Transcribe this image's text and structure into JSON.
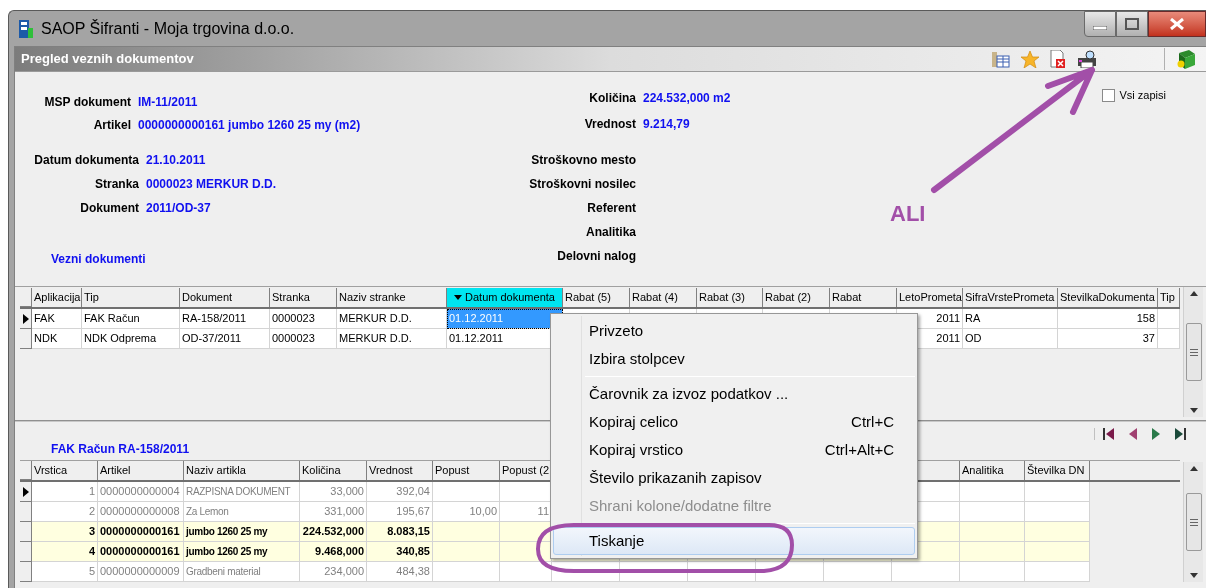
{
  "window": {
    "title": "SAOP Šifranti - Moja trgovina d.o.o."
  },
  "panel": {
    "title": "Pregled veznih dokumentov"
  },
  "document_info": {
    "left_groups": [
      [
        {
          "label": "MSP dokument",
          "value": "IM-11/2011"
        },
        {
          "label": "Artikel",
          "value": "0000000000161 jumbo 1260 25 my (m2)"
        }
      ],
      [
        {
          "label": "Datum dokumenta",
          "value": "21.10.2011"
        },
        {
          "label": "Stranka",
          "value": "0000023 MERKUR D.D."
        },
        {
          "label": "Dokument",
          "value": "2011/OD-37"
        }
      ]
    ],
    "right_groups": [
      [
        {
          "label": "Količina",
          "value": "224.532,000 m2"
        },
        {
          "label": "Vrednost",
          "value": "9.214,79"
        }
      ],
      [
        {
          "label": "Stroškovno mesto"
        },
        {
          "label": "Stroškovni nosilec"
        },
        {
          "label": "Referent"
        },
        {
          "label": "Analitika"
        },
        {
          "label": "Delovni nalog"
        }
      ]
    ]
  },
  "all_records": {
    "label": "Vsi zapisi",
    "checked": false
  },
  "linked_documents_label": "Vezni dokumenti",
  "documents_table": {
    "columns": [
      {
        "label": "Aplikacija",
        "sorted": false
      },
      {
        "label": "Tip",
        "sorted": false
      },
      {
        "label": "Dokument",
        "sorted": false
      },
      {
        "label": "Stranka",
        "sorted": false
      },
      {
        "label": "Naziv stranke",
        "sorted": false
      },
      {
        "label": "Datum dokumenta",
        "sorted": true
      },
      {
        "label": "Rabat (5)",
        "sorted": false
      },
      {
        "label": "Rabat (4)",
        "sorted": false
      },
      {
        "label": "Rabat (3)",
        "sorted": false
      },
      {
        "label": "Rabat (2)",
        "sorted": false
      },
      {
        "label": "Rabat",
        "sorted": false
      },
      {
        "label": "LetoPrometa",
        "sorted": false
      },
      {
        "label": "SifraVrstePrometa",
        "sorted": false
      },
      {
        "label": "StevilkaDokumenta",
        "sorted": false
      },
      {
        "label": "Tip",
        "sorted": false
      }
    ],
    "rows": [
      {
        "current": true,
        "cells": [
          "FAK",
          "FAK Račun",
          "RA-158/2011",
          "0000023",
          "MERKUR D.D.",
          "01.12.2011",
          null,
          null,
          null,
          null,
          null,
          "2011",
          "RA",
          "158",
          null
        ]
      },
      {
        "current": false,
        "cells": [
          "NDK",
          "NDK Odprema",
          "OD-37/2011",
          "0000023",
          "MERKUR D.D.",
          "01.12.2011",
          null,
          null,
          null,
          null,
          null,
          "2011",
          "OD",
          "37",
          null
        ]
      }
    ]
  },
  "detail_title": "FAK Račun RA-158/2011",
  "items_table": {
    "columns": [
      "Vrstica",
      "Artikel",
      "Naziv artikla",
      "Količina",
      "Vrednost",
      "Popust",
      "Popust (2",
      "Analitika",
      "Številka DN"
    ],
    "rows": [
      {
        "current": true,
        "highlighted": false,
        "cells": [
          "1",
          "0000000000004",
          "RAZPISNA DOKUMENT",
          "33,000",
          "392,04",
          null,
          null
        ]
      },
      {
        "current": false,
        "highlighted": false,
        "cells": [
          "2",
          "0000000000008",
          "Za Lemon",
          "331,000",
          "195,67",
          "10,00",
          "11"
        ]
      },
      {
        "current": false,
        "highlighted": true,
        "cells": [
          "3",
          "0000000000161",
          "jumbo 1260 25 my",
          "224.532,000",
          "8.083,15",
          null,
          null
        ]
      },
      {
        "current": false,
        "highlighted": true,
        "cells": [
          "4",
          "0000000000161",
          "jumbo 1260 25 my",
          "9.468,000",
          "340,85",
          null,
          null
        ]
      },
      {
        "current": false,
        "highlighted": false,
        "cells": [
          "5",
          "0000000000009",
          "Gradbeni material",
          "234,000",
          "484,38",
          null,
          null
        ]
      }
    ]
  },
  "context_menu": [
    {
      "kind": "item",
      "label": "Privzeto",
      "disabled": false,
      "selected": false
    },
    {
      "kind": "item",
      "label": "Izbira stolpcev",
      "disabled": false,
      "selected": false
    },
    {
      "kind": "separator"
    },
    {
      "kind": "item",
      "label": "Čarovnik za izvoz podatkov ...",
      "disabled": false,
      "selected": false
    },
    {
      "kind": "item",
      "label": "Kopiraj celico",
      "shortcut": "Ctrl+C",
      "disabled": false,
      "selected": false
    },
    {
      "kind": "item",
      "label": "Kopiraj vrstico",
      "shortcut": "Ctrl+Alt+C",
      "disabled": false,
      "selected": false
    },
    {
      "kind": "item",
      "label": "Število prikazanih zapisov",
      "disabled": false,
      "selected": false
    },
    {
      "kind": "item",
      "label": "Shrani kolone/dodatne filtre",
      "disabled": true,
      "selected": false
    },
    {
      "kind": "separator"
    },
    {
      "kind": "item",
      "label": "Tiskanje",
      "disabled": false,
      "selected": true
    }
  ],
  "annotation": {
    "label": "ALI",
    "color": "#a24fa8"
  }
}
